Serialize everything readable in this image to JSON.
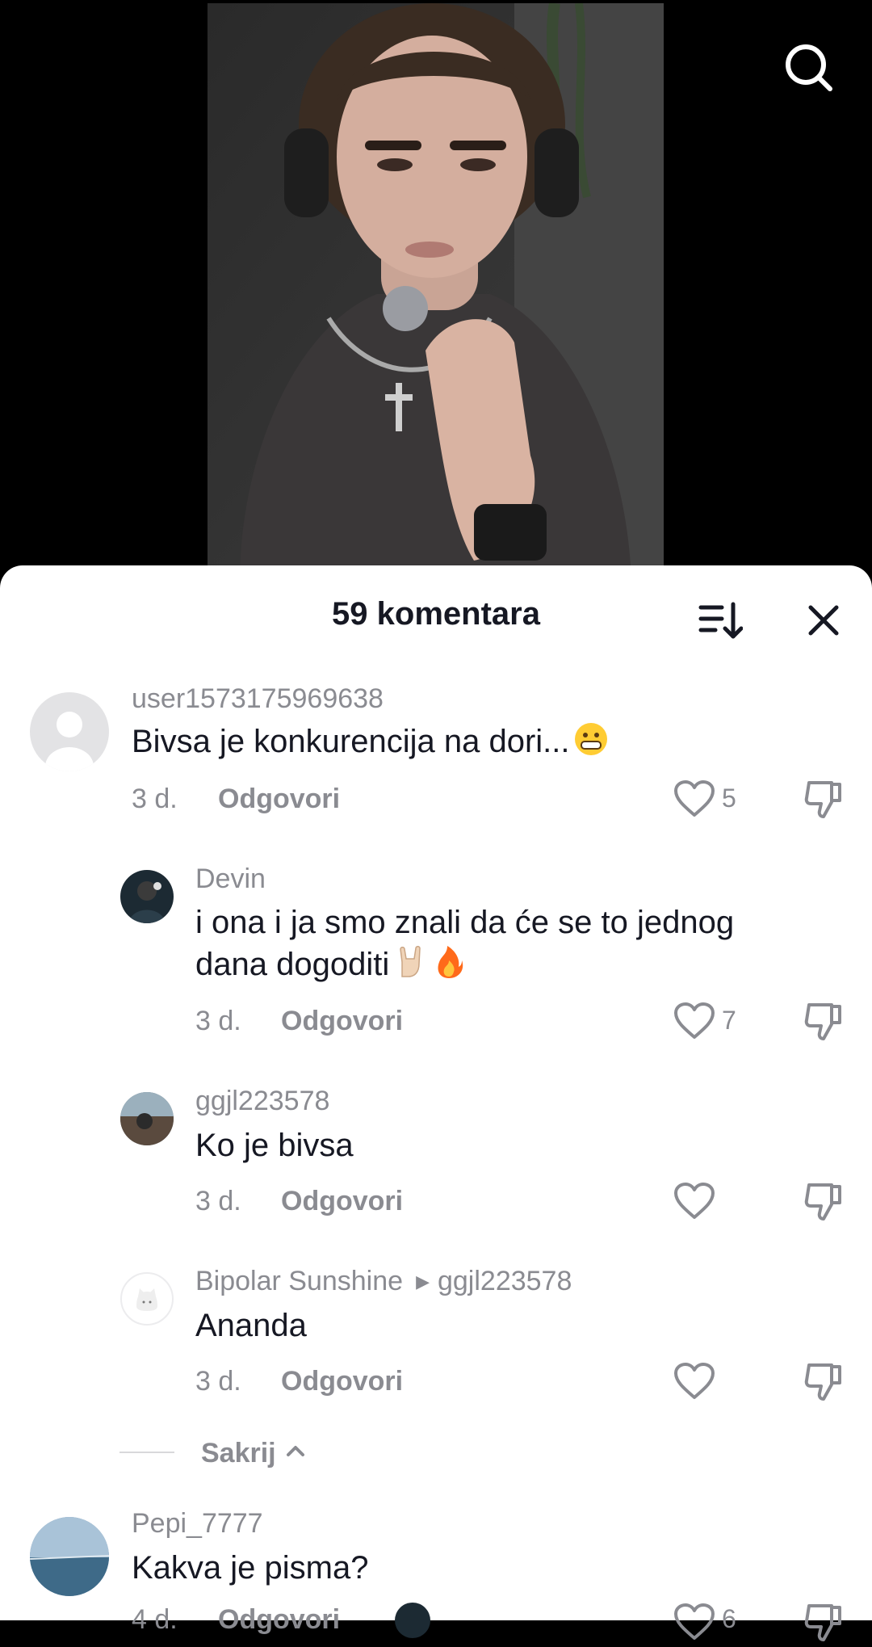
{
  "header": {
    "title": "59 komentara"
  },
  "comments": [
    {
      "username": "user1573175969638",
      "text": "Bivsa je konkurencija na dori...",
      "time": "3 d.",
      "reply": "Odgovori",
      "likes": "5"
    },
    {
      "username": "Devin",
      "text_line1": "i ona i ja smo znali da će se to jednog",
      "text_line2": "dana dogoditi",
      "time": "3 d.",
      "reply": "Odgovori",
      "likes": "7"
    },
    {
      "username": "ggjl223578",
      "text": "Ko je bivsa",
      "time": "3 d.",
      "reply": "Odgovori",
      "likes": ""
    },
    {
      "username": "Bipolar Sunshine",
      "reply_to": "ggjl223578",
      "text": "Ananda",
      "time": "3 d.",
      "reply": "Odgovori",
      "likes": ""
    },
    {
      "username": "Pepi_7777",
      "text": "Kakva je pisma?",
      "time": "4 d.",
      "reply": "Odgovori",
      "likes": "6"
    }
  ],
  "hide_label": "Sakrij",
  "icons": {
    "search": "search-icon",
    "sort": "sort-icon",
    "close": "close-icon",
    "like": "heart-icon",
    "dislike": "thumbs-down-icon",
    "collapse": "chevron-up-icon"
  }
}
